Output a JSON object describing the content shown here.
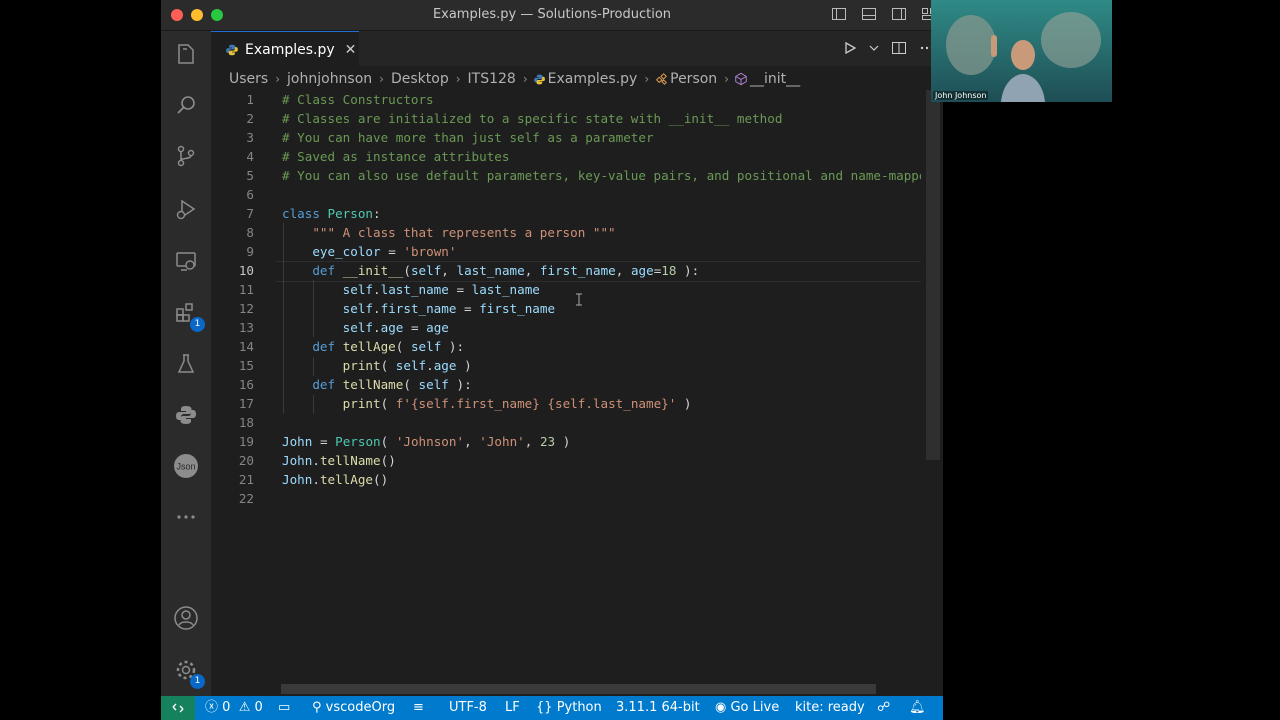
{
  "window": {
    "title": "Examples.py — Solutions-Production"
  },
  "tab": {
    "label": "Examples.py",
    "close": "✕"
  },
  "breadcrumb": [
    "Users",
    "johnjohnson",
    "Desktop",
    "ITS128",
    "Examples.py",
    "Person",
    "__init__"
  ],
  "activity": {
    "extensions_badge": "1",
    "settings_badge": "1"
  },
  "editor": {
    "line_numbers": [
      "1",
      "2",
      "3",
      "4",
      "5",
      "6",
      "7",
      "8",
      "9",
      "10",
      "11",
      "12",
      "13",
      "14",
      "15",
      "16",
      "17",
      "18",
      "19",
      "20",
      "21",
      "22"
    ],
    "current_line": "10",
    "lines": [
      "# Class Constructors",
      "# Classes are initialized to a specific state with __init__ method",
      "# You can have more than just self as a parameter",
      "# Saved as instance attributes",
      "# You can also use default parameters, key-value pairs, and positional and name-mappe",
      "",
      "class Person:",
      "    \"\"\" A class that represents a person \"\"\"",
      "    eye_color = 'brown'",
      "    def __init__(self, last_name, first_name, age=18 ):",
      "        self.last_name = last_name",
      "        self.first_name = first_name",
      "        self.age = age",
      "    def tellAge( self ):",
      "        print( self.age )",
      "    def tellName( self ):",
      "        print( f'{self.first_name} {self.last_name}' )",
      "",
      "John = Person( 'Johnson', 'John', 23 )",
      "John.tellName()",
      "John.tellAge()",
      ""
    ]
  },
  "status": {
    "errors": "0",
    "warnings": "0",
    "org": "vscodeOrg",
    "encoding": "UTF-8",
    "eol": "LF",
    "language": "Python",
    "interpreter": "3.11.1 64-bit",
    "golive": "Go Live",
    "kite": "kite: ready"
  },
  "camera": {
    "name": "John Johnson"
  },
  "colors": {
    "accent": "#007acc",
    "remote": "#16825d",
    "badge": "#0a68c8"
  }
}
